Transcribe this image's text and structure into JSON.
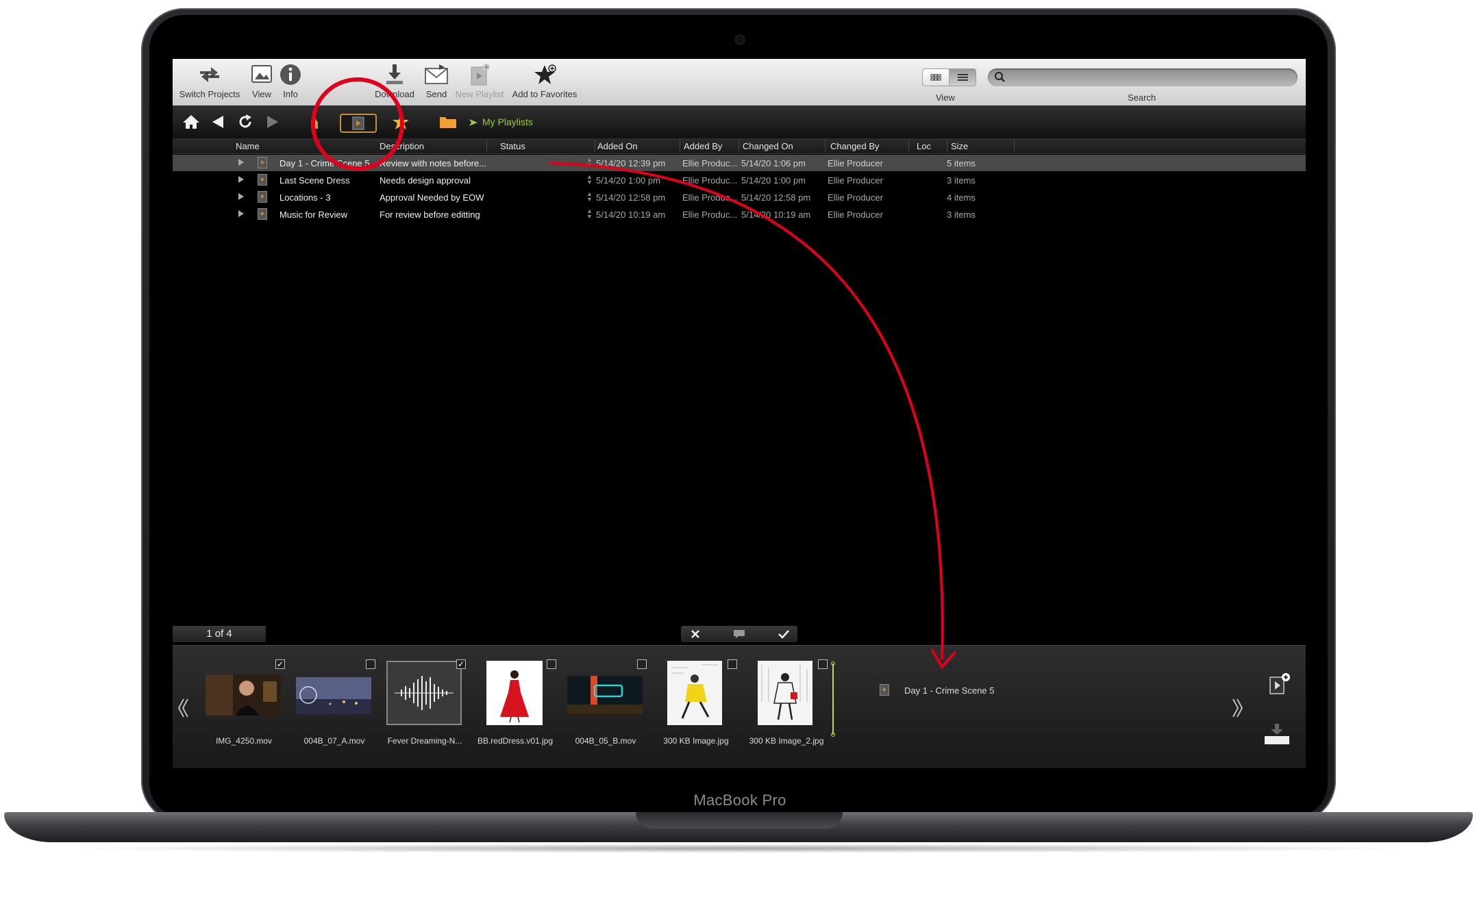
{
  "device": {
    "brand_label": "MacBook Pro"
  },
  "toolbar": {
    "switch_projects": "Switch Projects",
    "view": "View",
    "info": "Info",
    "download": "Download",
    "send": "Send",
    "new_playlist": "New Playlist",
    "add_to_favorites": "Add to Favorites",
    "view_mode_label": "View",
    "search_label": "Search"
  },
  "nav": {
    "breadcrumb": "My Playlists"
  },
  "table": {
    "headers": [
      "Name",
      "Description",
      "Status",
      "Added On",
      "Added By",
      "Changed On",
      "Changed By",
      "Loc",
      "Size"
    ],
    "rows": [
      {
        "name": "Day 1 - Crime Scene 5",
        "description": "Review with notes before...",
        "added_on": "5/14/20 12:39 pm",
        "added_by": "Ellie Produc...",
        "changed_on": "5/14/20 1:06 pm",
        "changed_by": "Ellie Producer",
        "size": "5 items",
        "selected": true
      },
      {
        "name": "Last Scene Dress",
        "description": "Needs design approval",
        "added_on": "5/14/20 1:00 pm",
        "added_by": "Ellie Produc...",
        "changed_on": "5/14/20 1:00 pm",
        "changed_by": "Ellie Producer",
        "size": "3 items",
        "selected": false
      },
      {
        "name": "Locations - 3",
        "description": "Approval Needed by EOW",
        "added_on": "5/14/20 12:58 pm",
        "added_by": "Ellie Produc...",
        "changed_on": "5/14/20 12:58 pm",
        "changed_by": "Ellie Producer",
        "size": "4 items",
        "selected": false
      },
      {
        "name": "Music for Review",
        "description": "For review before editting",
        "added_on": "5/14/20 10:19 am",
        "added_by": "Ellie Produc...",
        "changed_on": "5/14/20 10:19 am",
        "changed_by": "Ellie Producer",
        "size": "3 items",
        "selected": false
      }
    ]
  },
  "status": {
    "page_count": "1 of 4"
  },
  "tray": {
    "items": [
      {
        "label": "IMG_4250.mov",
        "checked": true
      },
      {
        "label": "004B_07_A.mov",
        "checked": false
      },
      {
        "label": "Fever Dreaming-N...",
        "checked": true
      },
      {
        "label": "BB.redDress.v01.jpg",
        "checked": false
      },
      {
        "label": "004B_05_B.mov",
        "checked": false
      },
      {
        "label": "300 KB Image.jpg",
        "checked": false
      },
      {
        "label": "300 KB Image_2.jpg",
        "checked": false
      }
    ],
    "target_playlist": "Day 1 - Crime Scene 5"
  },
  "colors": {
    "breadcrumb": "#9acb43",
    "annotation": "#e0001b",
    "playlist_highlight": "#c8903c",
    "selected_row": "#4a4a4a"
  }
}
